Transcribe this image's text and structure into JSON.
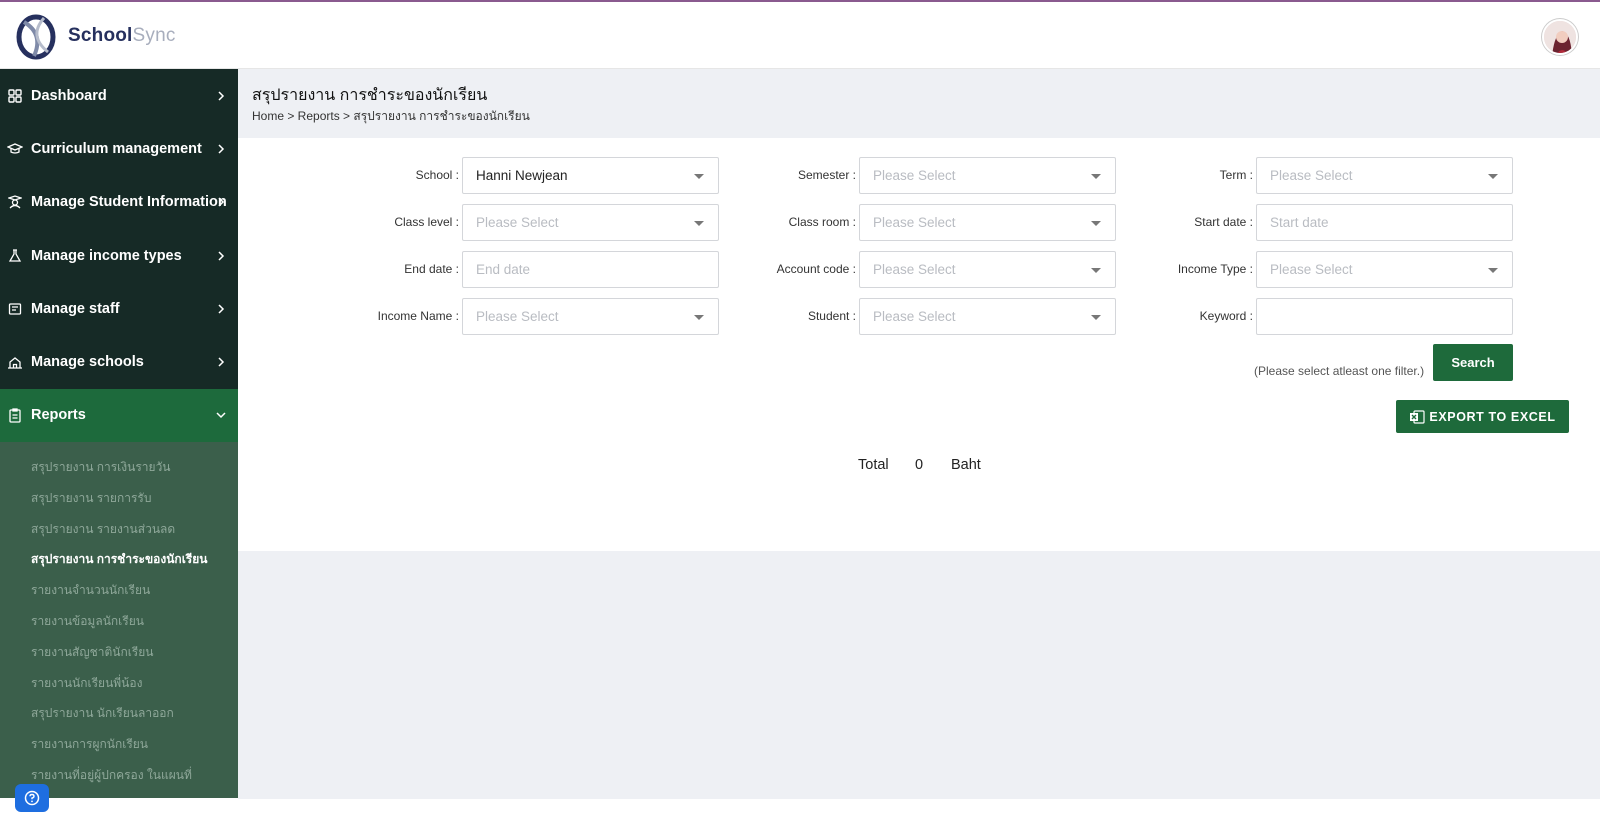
{
  "app": {
    "logo_main": "School",
    "logo_accent": "Sync"
  },
  "sidebar": {
    "items": [
      {
        "label": "Dashboard",
        "icon": "dashboard-grid-icon"
      },
      {
        "label": "Curriculum management",
        "icon": "graduation-cap-icon"
      },
      {
        "label": "Manage Student Information",
        "icon": "student-icon"
      },
      {
        "label": "Manage income types",
        "icon": "flask-icon"
      },
      {
        "label": "Manage staff",
        "icon": "staff-icon"
      },
      {
        "label": "Manage schools",
        "icon": "school-building-icon"
      },
      {
        "label": "Reports",
        "icon": "clipboard-icon"
      }
    ],
    "report_subitems": [
      "สรุปรายงาน การเงินรายวัน",
      "สรุปรายงาน รายการรับ",
      "สรุปรายงาน รายงานส่วนลด",
      "สรุปรายงาน การชำระของนักเรียน",
      "รายงานจำนวนนักเรียน",
      "รายงานข้อมูลนักเรียน",
      "รายงานสัญชาตินักเรียน",
      "รายงานนักเรียนพี่น้อง",
      "สรุปรายงาน นักเรียนลาออก",
      "รายงานการผูกนักเรียน",
      "รายงานที่อยู่ผู้ปกครอง ในแผนที่"
    ]
  },
  "header": {
    "title": "สรุปรายงาน การชำระของนักเรียน",
    "breadcrumb": "Home > Reports > สรุปรายงาน การชำระของนักเรียน"
  },
  "filters": {
    "school": {
      "label": "School :",
      "value": "Hanni Newjean"
    },
    "semester": {
      "label": "Semester :",
      "placeholder": "Please Select"
    },
    "term": {
      "label": "Term :",
      "placeholder": "Please Select"
    },
    "class_level": {
      "label": "Class level :",
      "placeholder": "Please Select"
    },
    "class_room": {
      "label": "Class room :",
      "placeholder": "Please Select"
    },
    "start_date": {
      "label": "Start date :",
      "placeholder": "Start date"
    },
    "end_date": {
      "label": "End date :",
      "placeholder": "End date"
    },
    "account_code": {
      "label": "Account code :",
      "placeholder": "Please Select"
    },
    "income_type": {
      "label": "Income Type :",
      "placeholder": "Please Select"
    },
    "income_name": {
      "label": "Income Name :",
      "placeholder": "Please Select"
    },
    "student": {
      "label": "Student :",
      "placeholder": "Please Select"
    },
    "keyword": {
      "label": "Keyword :",
      "value": ""
    }
  },
  "actions": {
    "hint": "(Please select atleast one filter.)",
    "search_label": "Search",
    "export_label": "EXPORT TO EXCEL"
  },
  "summary": {
    "total_label": "Total",
    "total_value": "0",
    "currency": "Baht"
  },
  "colors": {
    "sidebar_bg": "#162a26",
    "active_green": "#1d6a3c",
    "submenu_bg": "#3b5f4b",
    "button_green": "#1e6a3b"
  }
}
